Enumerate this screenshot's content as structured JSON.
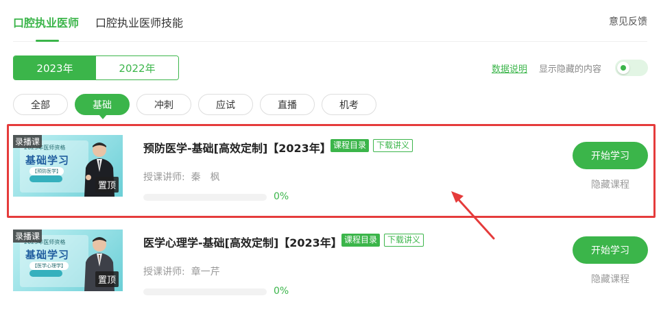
{
  "top_tabs": [
    {
      "label": "口腔执业医师",
      "active": true
    },
    {
      "label": "口腔执业医师技能",
      "active": false
    }
  ],
  "feedback_label": "意见反馈",
  "years": [
    {
      "label": "2023年",
      "active": true
    },
    {
      "label": "2022年",
      "active": false
    }
  ],
  "data_note_label": "数据说明",
  "show_hidden_label": "显示隐藏的内容",
  "show_hidden_enabled": true,
  "filters": [
    {
      "label": "全部",
      "active": false
    },
    {
      "label": "基础",
      "active": true
    },
    {
      "label": "冲刺",
      "active": false
    },
    {
      "label": "应试",
      "active": false
    },
    {
      "label": "直播",
      "active": false
    },
    {
      "label": "机考",
      "active": false
    }
  ],
  "courses": [
    {
      "title": "预防医学-基础[高效定制]【2023年】",
      "catalog_label": "课程目录",
      "download_label": "下载讲义",
      "teacher_label": "授课讲师:",
      "teacher_name": "秦　枫",
      "progress_percent": 0,
      "progress_text": "0%",
      "start_label": "开始学习",
      "hide_label": "隐藏课程",
      "thumb": {
        "record_tag": "录播课",
        "top_tag": "置顶",
        "year_text": "2023年医师资格",
        "title_text": "基础学习",
        "subject_text": "【预防医学】"
      }
    },
    {
      "title": "医学心理学-基础[高效定制]【2023年】",
      "catalog_label": "课程目录",
      "download_label": "下载讲义",
      "teacher_label": "授课讲师:",
      "teacher_name": "章一芹",
      "progress_percent": 0,
      "progress_text": "0%",
      "start_label": "开始学习",
      "hide_label": "隐藏课程",
      "thumb": {
        "record_tag": "录播课",
        "top_tag": "置顶",
        "year_text": "2023年医师资格",
        "title_text": "基础学习",
        "subject_text": "【医学心理学】"
      }
    }
  ],
  "colors": {
    "accent": "#3bb54a",
    "highlight": "#e53b3b"
  }
}
